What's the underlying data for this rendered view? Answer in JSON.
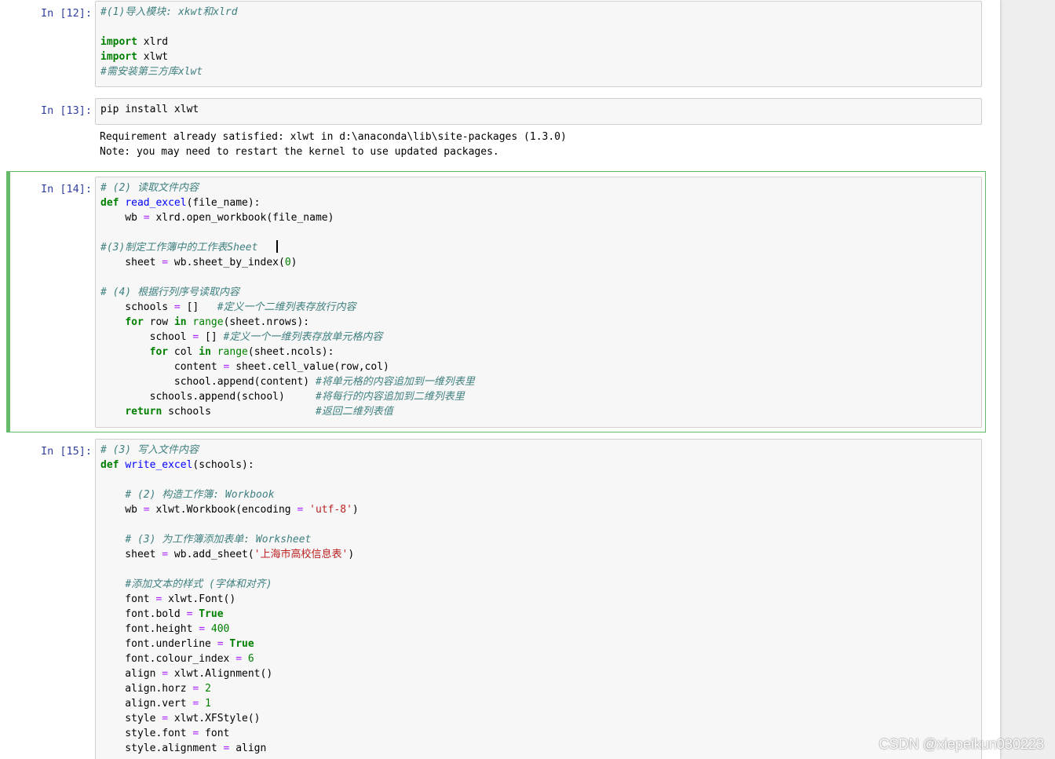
{
  "cells": [
    {
      "prompt": "In  [12]:",
      "selected": false,
      "lines": [
        [
          [
            "cm",
            "#(1)导入模块: xkwt和xlrd"
          ]
        ],
        [],
        [
          [
            "kw",
            "import"
          ],
          [
            "",
            " xlrd"
          ]
        ],
        [
          [
            "kw",
            "import"
          ],
          [
            "",
            " xlwt"
          ]
        ],
        [
          [
            "cm",
            "#需安装第三方库xlwt"
          ]
        ]
      ],
      "output": []
    },
    {
      "prompt": "In  [13]:",
      "selected": false,
      "lines": [
        [
          [
            "",
            "pip install xlwt"
          ]
        ]
      ],
      "output": [
        "Requirement already satisfied: xlwt in d:\\anaconda\\lib\\site-packages (1.3.0)",
        "Note: you may need to restart the kernel to use updated packages."
      ]
    },
    {
      "prompt": "In  [14]:",
      "selected": true,
      "lines": [
        [
          [
            "cm",
            "# (2) 读取文件内容"
          ]
        ],
        [
          [
            "kw",
            "def"
          ],
          [
            "",
            " "
          ],
          [
            "fn",
            "read_excel"
          ],
          [
            "",
            "(file_name):"
          ]
        ],
        [
          [
            "",
            "    wb "
          ],
          [
            "op",
            "="
          ],
          [
            "",
            " xlrd.open_workbook(file_name)"
          ]
        ],
        [],
        [
          [
            "cm",
            "#(3)制定工作簿中的工作表Sheet"
          ],
          [
            "",
            "   "
          ],
          [
            "cursor",
            ""
          ]
        ],
        [
          [
            "",
            "    sheet "
          ],
          [
            "op",
            "="
          ],
          [
            "",
            " wb.sheet_by_index("
          ],
          [
            "nm",
            "0"
          ],
          [
            "",
            ")"
          ]
        ],
        [],
        [
          [
            "cm",
            "# (4) 根据行列序号读取内容"
          ]
        ],
        [
          [
            "",
            "    schools "
          ],
          [
            "op",
            "="
          ],
          [
            "",
            " []   "
          ],
          [
            "cm",
            "#定义一个二维列表存放行内容"
          ]
        ],
        [
          [
            "",
            "    "
          ],
          [
            "kw",
            "for"
          ],
          [
            "",
            " row "
          ],
          [
            "kw",
            "in"
          ],
          [
            "",
            " "
          ],
          [
            "bi",
            "range"
          ],
          [
            "",
            "(sheet.nrows):"
          ]
        ],
        [
          [
            "",
            "        school "
          ],
          [
            "op",
            "="
          ],
          [
            "",
            " [] "
          ],
          [
            "cm",
            "#定义一个一维列表存放单元格内容"
          ]
        ],
        [
          [
            "",
            "        "
          ],
          [
            "kw",
            "for"
          ],
          [
            "",
            " col "
          ],
          [
            "kw",
            "in"
          ],
          [
            "",
            " "
          ],
          [
            "bi",
            "range"
          ],
          [
            "",
            "(sheet.ncols):"
          ]
        ],
        [
          [
            "",
            "            content "
          ],
          [
            "op",
            "="
          ],
          [
            "",
            " sheet.cell_value(row,col)"
          ]
        ],
        [
          [
            "",
            "            school.append(content) "
          ],
          [
            "cm",
            "#将单元格的内容追加到一维列表里"
          ]
        ],
        [
          [
            "",
            "        schools.append(school)     "
          ],
          [
            "cm",
            "#将每行的内容追加到二维列表里"
          ]
        ],
        [
          [
            "",
            "    "
          ],
          [
            "kw",
            "return"
          ],
          [
            "",
            " schools                 "
          ],
          [
            "cm",
            "#返回二维列表值"
          ]
        ]
      ],
      "output": []
    },
    {
      "prompt": "In  [15]:",
      "selected": false,
      "lines": [
        [
          [
            "cm",
            "# (3) 写入文件内容"
          ]
        ],
        [
          [
            "kw",
            "def"
          ],
          [
            "",
            " "
          ],
          [
            "fn",
            "write_excel"
          ],
          [
            "",
            "(schools):"
          ]
        ],
        [],
        [
          [
            "",
            "    "
          ],
          [
            "cm",
            "# (2) 构造工作簿: Workbook"
          ]
        ],
        [
          [
            "",
            "    wb "
          ],
          [
            "op",
            "="
          ],
          [
            "",
            " xlwt.Workbook(encoding "
          ],
          [
            "op",
            "="
          ],
          [
            "",
            " "
          ],
          [
            "st",
            "'utf-8'"
          ],
          [
            "",
            ")"
          ]
        ],
        [],
        [
          [
            "",
            "    "
          ],
          [
            "cm",
            "# (3) 为工作簿添加表单: Worksheet"
          ]
        ],
        [
          [
            "",
            "    sheet "
          ],
          [
            "op",
            "="
          ],
          [
            "",
            " wb.add_sheet("
          ],
          [
            "st",
            "'上海市高校信息表'"
          ],
          [
            "",
            ")"
          ]
        ],
        [],
        [
          [
            "",
            "    "
          ],
          [
            "cm",
            "#添加文本的样式 (字体和对齐)"
          ]
        ],
        [
          [
            "",
            "    font "
          ],
          [
            "op",
            "="
          ],
          [
            "",
            " xlwt.Font()"
          ]
        ],
        [
          [
            "",
            "    font.bold "
          ],
          [
            "op",
            "="
          ],
          [
            "",
            " "
          ],
          [
            "kw",
            "True"
          ]
        ],
        [
          [
            "",
            "    font.height "
          ],
          [
            "op",
            "="
          ],
          [
            "",
            " "
          ],
          [
            "nm",
            "400"
          ]
        ],
        [
          [
            "",
            "    font.underline "
          ],
          [
            "op",
            "="
          ],
          [
            "",
            " "
          ],
          [
            "kw",
            "True"
          ]
        ],
        [
          [
            "",
            "    font.colour_index "
          ],
          [
            "op",
            "="
          ],
          [
            "",
            " "
          ],
          [
            "nm",
            "6"
          ]
        ],
        [
          [
            "",
            "    align "
          ],
          [
            "op",
            "="
          ],
          [
            "",
            " xlwt.Alignment()"
          ]
        ],
        [
          [
            "",
            "    align.horz "
          ],
          [
            "op",
            "="
          ],
          [
            "",
            " "
          ],
          [
            "nm",
            "2"
          ]
        ],
        [
          [
            "",
            "    align.vert "
          ],
          [
            "op",
            "="
          ],
          [
            "",
            " "
          ],
          [
            "nm",
            "1"
          ]
        ],
        [
          [
            "",
            "    style "
          ],
          [
            "op",
            "="
          ],
          [
            "",
            " xlwt.XFStyle()"
          ]
        ],
        [
          [
            "",
            "    style.font "
          ],
          [
            "op",
            "="
          ],
          [
            "",
            " font"
          ]
        ],
        [
          [
            "",
            "    style.alignment "
          ],
          [
            "op",
            "="
          ],
          [
            "",
            " align"
          ]
        ]
      ],
      "output": []
    }
  ],
  "watermark": "CSDN @xiepeikun030223",
  "colors": {
    "prompt": "#303f9f",
    "comment": "#408080",
    "keyword": "#008000",
    "function": "#0000ff",
    "string": "#ba2121",
    "operator": "#aa22ff",
    "selected_border": "#66bb6a"
  }
}
